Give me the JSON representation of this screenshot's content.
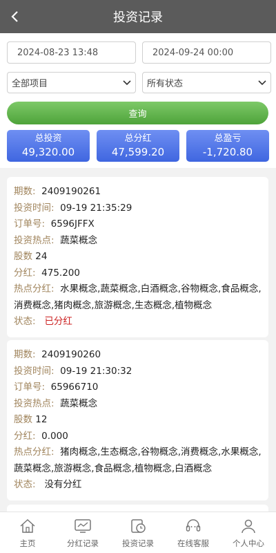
{
  "header": {
    "title": "投资记录"
  },
  "filters": {
    "start_date": "2024-08-23 13:48",
    "end_date": "2024-09-24 00:00",
    "project_select": "全部项目",
    "status_select": "所有状态",
    "query_label": "查询"
  },
  "stats": [
    {
      "label": "总投资",
      "value": "49,320.00"
    },
    {
      "label": "总分红",
      "value": "47,599.20"
    },
    {
      "label": "总盈亏",
      "value": "-1,720.80"
    }
  ],
  "labels": {
    "period": "期数:",
    "time": "投资时间:",
    "order": "订单号:",
    "hotspot": "投资热点:",
    "shares": "股数",
    "dividend": "分红:",
    "hot_dividend": "热点分红:",
    "status": "状态:"
  },
  "records": [
    {
      "period": "2409190261",
      "time": "09-19 21:35:29",
      "order": "6596JFFX",
      "hotspot": "蔬菜概念",
      "shares": "24",
      "dividend": "475.200",
      "hot_dividend": "水果概念,蔬菜概念,白酒概念,谷物概念,食品概念,消费概念,猪肉概念,旅游概念,生态概念,植物概念",
      "status": "已分红"
    },
    {
      "period": "2409190260",
      "time": "09-19 21:30:32",
      "order": "65966710",
      "hotspot": "蔬菜概念",
      "shares": "12",
      "dividend": "0.000",
      "hot_dividend": "猪肉概念,生态概念,谷物概念,消费概念,水果概念,蔬菜概念,旅游概念,食品概念,植物概念,白酒概念",
      "status": "没有分红"
    }
  ],
  "tabbar": [
    {
      "label": "主页",
      "icon": "home-icon"
    },
    {
      "label": "分红记录",
      "icon": "chart-icon"
    },
    {
      "label": "投资记录",
      "icon": "clock-icon"
    },
    {
      "label": "在线客服",
      "icon": "headset-icon"
    },
    {
      "label": "个人中心",
      "icon": "user-icon"
    }
  ],
  "colors": {
    "header_bg": "#5b5b5b",
    "query_green": "#5cb146",
    "stat_blue": "#4f73e6",
    "status_red": "#cc2222",
    "label_brown": "#a0845c"
  }
}
